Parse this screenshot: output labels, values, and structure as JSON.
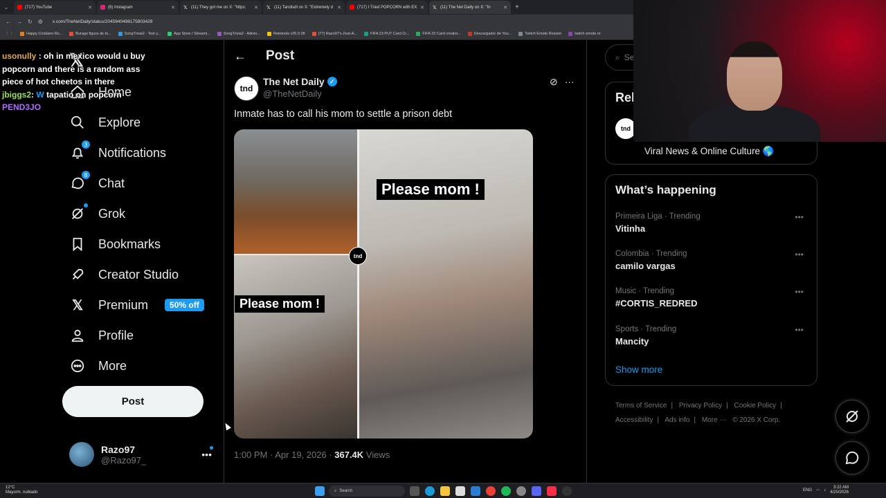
{
  "browser": {
    "tabs": [
      {
        "title": "(717) YouTube",
        "color": "#ff0000"
      },
      {
        "title": "(6) Instagram",
        "color": "#d62976"
      },
      {
        "title": "(11) They got me on X: \"https:",
        "color": "#ffffff"
      },
      {
        "title": "(11) Tarolisdl on X: \"Extremely d",
        "color": "#ffffff"
      },
      {
        "title": "(717) I Tried POPCORN with EX",
        "color": "#ff0000"
      },
      {
        "title": "(11) The Net Daily on X: \"In",
        "color": "#ffffff"
      }
    ],
    "url": "x.com/TheNetDaily/status/2045940498175803429",
    "bookmarks": [
      {
        "label": "Happy Cristiano Ro...",
        "color": "#e67e22"
      },
      {
        "label": "Burago figura de to...",
        "color": "#e74c3c"
      },
      {
        "label": "SongTrivia2 - Test y...",
        "color": "#3498db"
      },
      {
        "label": "App Store / Streami...",
        "color": "#2ecc71"
      },
      {
        "label": "SongTrivia2 - Adivin...",
        "color": "#9b59b6"
      },
      {
        "label": "Reletools v26.0.28",
        "color": "#f1c40f"
      },
      {
        "label": "(77) Razo97's Zest-A...",
        "color": "#e74c3c"
      },
      {
        "label": "FIFA 23 PUT Card Cr...",
        "color": "#16a085"
      },
      {
        "label": "FIFA 23 Card creator...",
        "color": "#27ae60"
      },
      {
        "label": "Descargador de You...",
        "color": "#c0392b"
      },
      {
        "label": "Twitch Emote Resizer",
        "color": "#7f8c8d"
      },
      {
        "label": "twitch emote re",
        "color": "#8e44ad"
      }
    ]
  },
  "chat": [
    {
      "user": "usonully",
      "text": ": oh in mexico would u buy popcorn and there is a random ass piece of hot cheetos in there"
    },
    {
      "user": "jbiggs2",
      "text": "tapatio on popcorn"
    },
    {
      "user": "PEND3JO",
      "text": ""
    }
  ],
  "nav": {
    "items": [
      {
        "label": "Home",
        "icon": "home-icon"
      },
      {
        "label": "Explore",
        "icon": "search-icon"
      },
      {
        "label": "Notifications",
        "icon": "bell-icon",
        "badge": "3"
      },
      {
        "label": "Chat",
        "icon": "chat-icon",
        "badge": "8"
      },
      {
        "label": "Grok",
        "icon": "grok-icon"
      },
      {
        "label": "Bookmarks",
        "icon": "bookmark-icon"
      },
      {
        "label": "Creator Studio",
        "icon": "rocket-icon"
      },
      {
        "label": "Premium",
        "icon": "x-logo-icon",
        "promo": "50% off"
      },
      {
        "label": "Profile",
        "icon": "person-icon"
      },
      {
        "label": "More",
        "icon": "more-circle-icon"
      }
    ],
    "post_button": "Post",
    "account": {
      "name": "Razo97",
      "handle": "@Razo97_"
    }
  },
  "post": {
    "header": "Post",
    "author_name": "The Net Daily",
    "author_handle": "@TheNetDaily",
    "avatar_text": "tnd",
    "text": "Inmate has to call his mom to settle a prison debt",
    "media_captions": [
      "Please mom !",
      "Please mom !"
    ],
    "time": "1:00 PM · Apr 19, 2026 · ",
    "views_count": "367.4K",
    "views_label": " Views"
  },
  "right": {
    "search_placeholder": "Se",
    "relevant_title": "Rel",
    "relevant_bio": "Viral News & Online Culture 🌎",
    "happening_title": "What’s happening",
    "trends": [
      {
        "category": "Primeira Liga · Trending",
        "name": "Vitinha"
      },
      {
        "category": "Colombia · Trending",
        "name": "camilo vargas"
      },
      {
        "category": "Music · Trending",
        "name": "#CORTIS_REDRED"
      },
      {
        "category": "Sports · Trending",
        "name": "Mancity"
      }
    ],
    "show_more": "Show more",
    "footer": [
      "Terms of Service",
      "|",
      "Privacy Policy",
      "|",
      "Cookie Policy",
      "|",
      "Accessibility",
      "|",
      "Ads info",
      "|",
      "More ···",
      "© 2026 X Corp."
    ]
  },
  "taskbar": {
    "weather_temp": "12°C",
    "weather_desc": "Mayorm. nublado",
    "search": "Search",
    "lang": "ENG",
    "time": "3:22 AM",
    "date": "4/20/2026"
  },
  "colors": {
    "accent": "#1d9bf0",
    "background": "#000000",
    "text": "#e7e9ea",
    "muted": "#71767b"
  }
}
